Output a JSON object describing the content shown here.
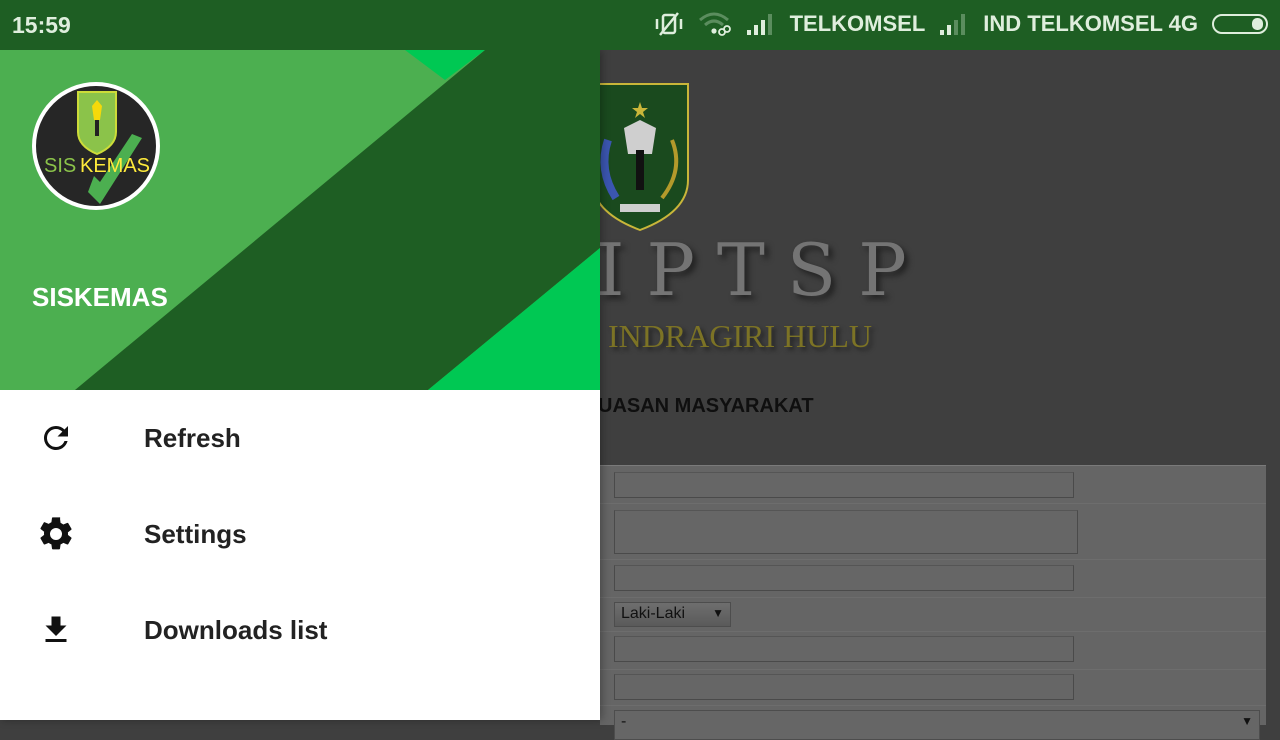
{
  "status_bar": {
    "time": "15:59",
    "carrier_1": "TELKOMSEL",
    "carrier_2": "IND TELKOMSEL 4G",
    "icons": [
      "vibrate-off-icon",
      "wifi-link-icon",
      "signal-icon",
      "signal-icon",
      "battery-icon"
    ]
  },
  "drawer": {
    "app_name": "SISKEMAS",
    "logo_text_left": "SIS",
    "logo_text_right": "KEMAS",
    "colors": {
      "header_light": "#4caf50",
      "header_dark": "#1e5e23",
      "header_accent": "#00c853"
    },
    "items": [
      {
        "label": "Refresh",
        "icon": "refresh-icon"
      },
      {
        "label": "Settings",
        "icon": "gear-icon"
      },
      {
        "label": "Downloads list",
        "icon": "download-icon"
      }
    ]
  },
  "background_page": {
    "title": "IPTSP",
    "region": "INDRAGIRI HULU",
    "subtitle": "UASAN MASYARAKAT",
    "form": {
      "gender_select": "Laki-Laki",
      "last_select": "-"
    }
  }
}
